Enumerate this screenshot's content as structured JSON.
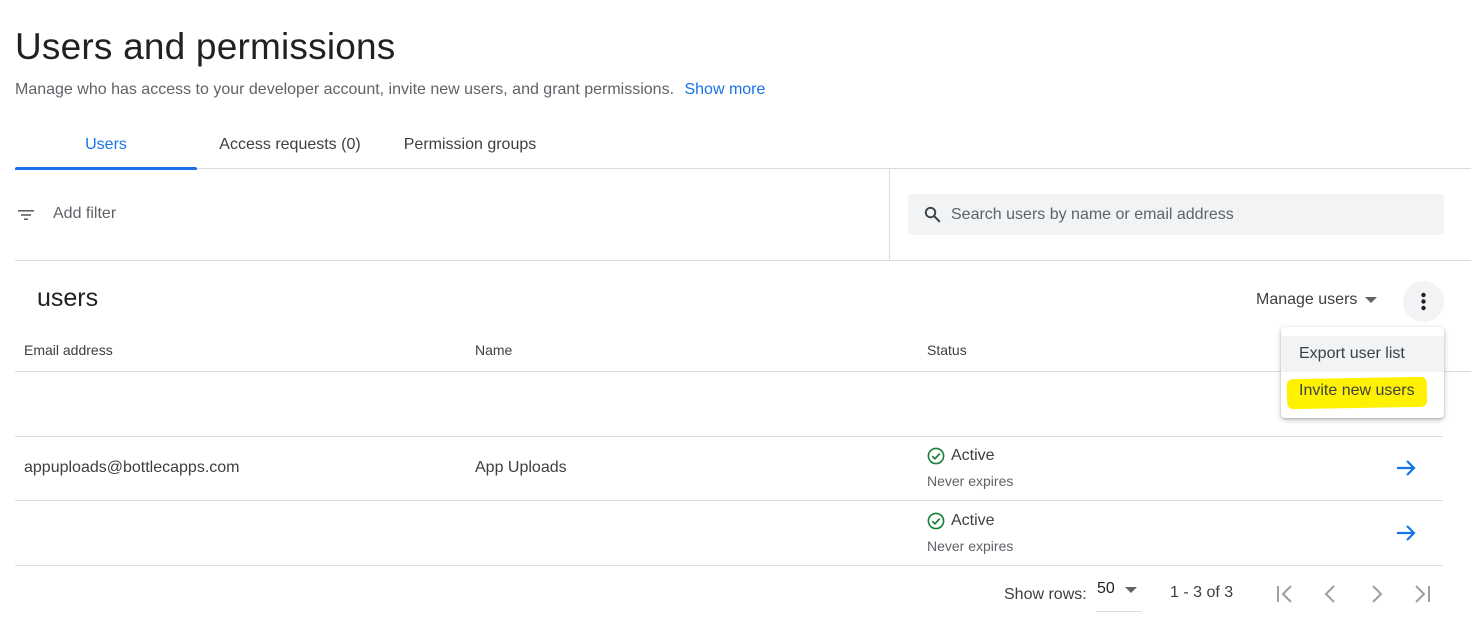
{
  "header": {
    "title": "Users and permissions",
    "subtitle": "Manage who has access to your developer account, invite new users, and grant permissions.",
    "show_more": "Show more"
  },
  "tabs": [
    {
      "label": "Users",
      "active": true
    },
    {
      "label": "Access requests (0)",
      "active": false
    },
    {
      "label": "Permission groups",
      "active": false
    }
  ],
  "filter": {
    "add_filter_label": "Add filter",
    "search_placeholder": "Search users by name or email address",
    "filter_icon": "filter-list-icon",
    "search_icon": "search-icon"
  },
  "section": {
    "title": "users",
    "manage_users": "Manage users"
  },
  "menu": {
    "items": [
      {
        "label": "Export user list"
      },
      {
        "label": "Invite new users",
        "highlighted": true
      }
    ]
  },
  "table": {
    "columns": [
      "Email address",
      "Name",
      "Status"
    ],
    "rows": [
      {
        "email": "",
        "name": "",
        "status": "",
        "status_sub": ""
      },
      {
        "email": "appuploads@bottlecapps.com",
        "name": "App Uploads",
        "status": "Active",
        "status_sub": "Never expires"
      },
      {
        "email": "",
        "name": "",
        "status": "Active",
        "status_sub": "Never expires"
      }
    ]
  },
  "pagination": {
    "show_rows_label": "Show rows:",
    "rows_per_page": "50",
    "range": "1 - 3 of 3"
  },
  "colors": {
    "accent": "#1a73e8",
    "status_green": "#188038",
    "highlight": "#fff200"
  }
}
